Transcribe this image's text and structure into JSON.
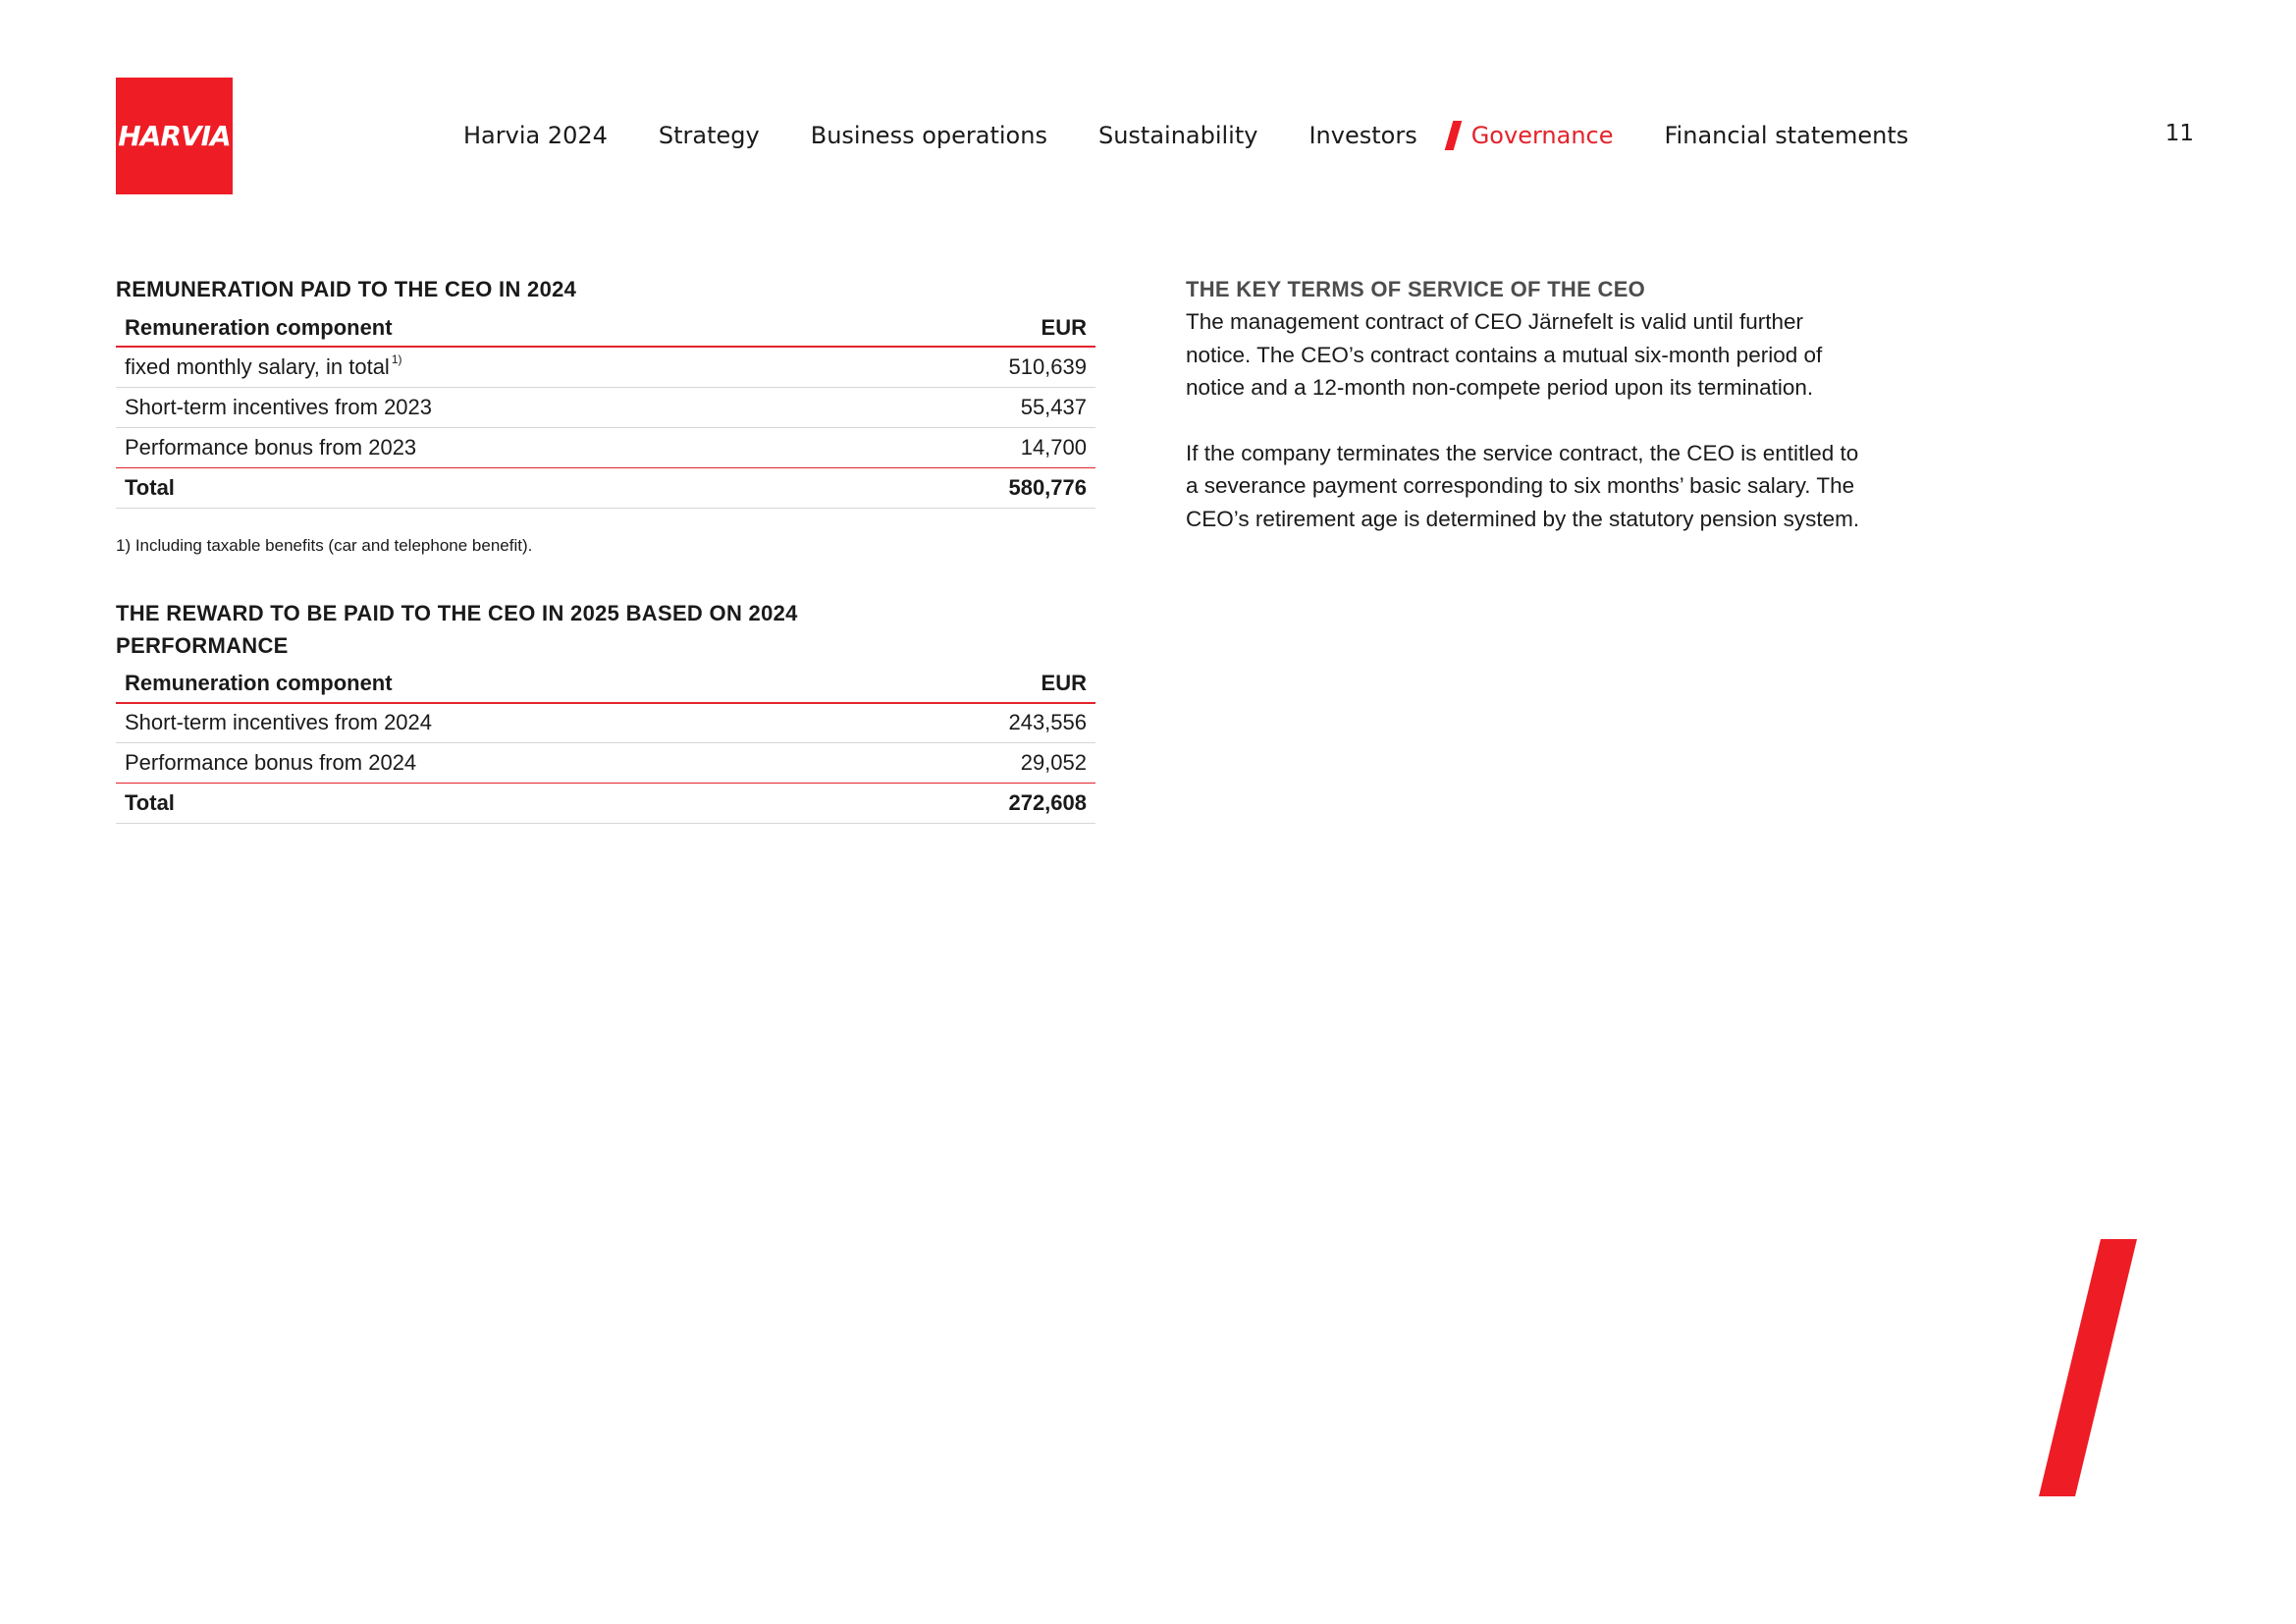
{
  "logo": {
    "text": "HARVIA"
  },
  "nav": {
    "items": [
      {
        "label": "Harvia 2024"
      },
      {
        "label": "Strategy"
      },
      {
        "label": "Business operations"
      },
      {
        "label": "Sustainability"
      },
      {
        "label": "Investors"
      },
      {
        "label": "Governance",
        "active": true
      },
      {
        "label": "Financial statements"
      }
    ],
    "page_number": "11"
  },
  "table1": {
    "title": "REMUNERATION PAID TO THE CEO IN 2024",
    "headers": [
      "Remuneration component",
      "EUR"
    ],
    "rows": [
      {
        "label": "fixed monthly salary, in total",
        "footnote_mark": "1)",
        "value": "510,639"
      },
      {
        "label": "Short-term incentives from 2023",
        "value": "55,437"
      },
      {
        "label": "Performance bonus from 2023",
        "value": "14,700"
      }
    ],
    "total": {
      "label": "Total",
      "value": "580,776"
    },
    "footnote": "1) Including taxable benefits (car and telephone benefit)."
  },
  "table2": {
    "title": "THE REWARD TO BE PAID TO THE CEO IN 2025 BASED ON 2024 PERFORMANCE",
    "headers": [
      "Remuneration component",
      "EUR"
    ],
    "rows": [
      {
        "label": "Short-term incentives from 2024",
        "value": "243,556"
      },
      {
        "label": "Performance bonus from 2024",
        "value": "29,052"
      }
    ],
    "total": {
      "label": "Total",
      "value": "272,608"
    }
  },
  "key_terms": {
    "title": "THE KEY TERMS OF SERVICE OF THE CEO",
    "paragraphs": [
      "The management contract of CEO Järnefelt is valid until further notice. The CEO’s contract contains a mutual six-month period of notice and a 12-month non-compete period upon its termination.",
      "If the company terminates the service contract, the CEO is entitled to a severance payment corresponding to six months’ basic salary. The CEO’s retirement age is determined by the statutory pension system."
    ]
  },
  "colors": {
    "brand_red": "#ee1c25",
    "active_nav": "#e3232b",
    "rule_gray": "#d6d6d6"
  }
}
